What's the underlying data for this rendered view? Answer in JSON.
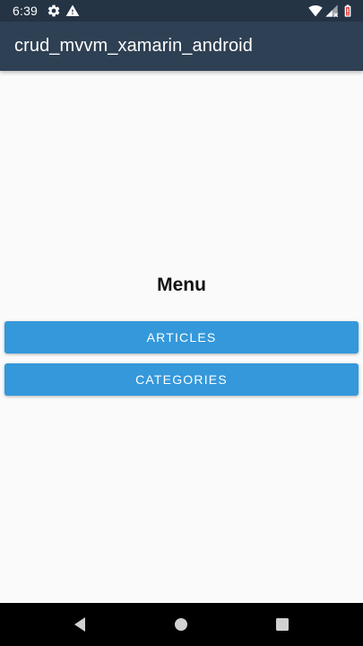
{
  "status_bar": {
    "time": "6:39",
    "left_icons": [
      "gear-icon",
      "warning-icon"
    ],
    "right_icons": [
      "wifi-icon",
      "signal-icon",
      "battery-icon"
    ]
  },
  "app_bar": {
    "title": "crud_mvvm_xamarin_android"
  },
  "main": {
    "heading": "Menu",
    "buttons": [
      {
        "label": "ARTICLES"
      },
      {
        "label": "CATEGORIES"
      }
    ]
  },
  "nav_bar": {
    "icons": [
      "back-icon",
      "home-icon",
      "recents-icon"
    ]
  },
  "colors": {
    "status_bar": "#253445",
    "app_bar": "#2e4053",
    "background": "#fafafa",
    "button": "#3498db",
    "button_text": "#ffffff",
    "battery_alert": "#e53935"
  }
}
